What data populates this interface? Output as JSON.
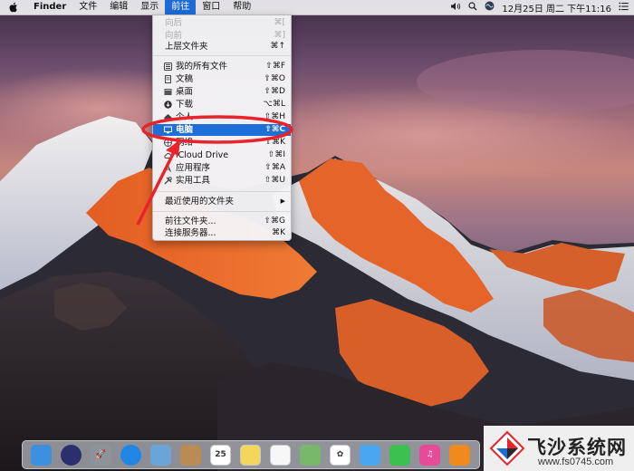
{
  "menubar": {
    "app_name": "Finder",
    "items": [
      "文件",
      "编辑",
      "显示",
      "前往",
      "窗口",
      "帮助"
    ],
    "active_item": "前往",
    "status_icons": [
      "audio-icon",
      "spotlight-icon",
      "siri-icon",
      "notification-center-icon"
    ],
    "clock": "12月25日 周二 下午11:16"
  },
  "go_menu": {
    "items": [
      {
        "label": "向后",
        "shortcut": "⌘[",
        "disabled": true
      },
      {
        "label": "向前",
        "shortcut": "⌘]",
        "disabled": true
      },
      {
        "label": "上层文件夹",
        "shortcut": "⌘↑"
      },
      {
        "label": "我的所有文件",
        "shortcut": "⇧⌘F",
        "icon": "all-files-icon"
      },
      {
        "label": "文稿",
        "shortcut": "⇧⌘O",
        "icon": "documents-icon"
      },
      {
        "label": "桌面",
        "shortcut": "⇧⌘D",
        "icon": "desktop-icon"
      },
      {
        "label": "下载",
        "shortcut": "⌥⌘L",
        "icon": "downloads-icon"
      },
      {
        "label": "个人",
        "shortcut": "⇧⌘H",
        "icon": "home-icon"
      },
      {
        "label": "电脑",
        "shortcut": "⇧⌘C",
        "icon": "computer-icon",
        "highlighted": true
      },
      {
        "label": "网络",
        "shortcut": "⇧⌘K",
        "icon": "network-icon"
      },
      {
        "label": "iCloud Drive",
        "shortcut": "⇧⌘I",
        "icon": "icloud-icon"
      },
      {
        "label": "应用程序",
        "shortcut": "⇧⌘A",
        "icon": "applications-icon"
      },
      {
        "label": "实用工具",
        "shortcut": "⇧⌘U",
        "icon": "utilities-icon"
      },
      {
        "label": "最近使用的文件夹",
        "shortcut": "▶"
      },
      {
        "label": "前往文件夹...",
        "shortcut": "⇧⌘G"
      },
      {
        "label": "连接服务器...",
        "shortcut": "⌘K"
      }
    ]
  },
  "annotation": {
    "color": "#e8232c"
  },
  "dock": {
    "apps": [
      {
        "name": "finder-icon",
        "color": "#3d8fe0",
        "glyph": ""
      },
      {
        "name": "siri-icon",
        "color": "#2b2f6e",
        "glyph": ""
      },
      {
        "name": "launchpad-icon",
        "color": "#8e9399",
        "glyph": "🚀"
      },
      {
        "name": "safari-icon",
        "color": "#1f86e6",
        "glyph": ""
      },
      {
        "name": "mail-icon",
        "color": "#6aa4d8",
        "glyph": ""
      },
      {
        "name": "contacts-icon",
        "color": "#b98b55",
        "glyph": ""
      },
      {
        "name": "calendar-icon",
        "color": "#ffffff",
        "glyph": "25"
      },
      {
        "name": "notes-icon",
        "color": "#f3d75a",
        "glyph": ""
      },
      {
        "name": "reminders-icon",
        "color": "#f7f7f7",
        "glyph": ""
      },
      {
        "name": "maps-icon",
        "color": "#77b86a",
        "glyph": ""
      },
      {
        "name": "photos-icon",
        "color": "#ffffff",
        "glyph": "✿"
      },
      {
        "name": "messages-icon",
        "color": "#4aa6f0",
        "glyph": ""
      },
      {
        "name": "facetime-icon",
        "color": "#3cc04f",
        "glyph": ""
      },
      {
        "name": "itunes-icon",
        "color": "#e84a9a",
        "glyph": "♫"
      },
      {
        "name": "ibooks-icon",
        "color": "#f08a1c",
        "glyph": ""
      }
    ]
  },
  "watermark": {
    "brand": "飞沙系统网",
    "site": "www.fs0745.com"
  }
}
